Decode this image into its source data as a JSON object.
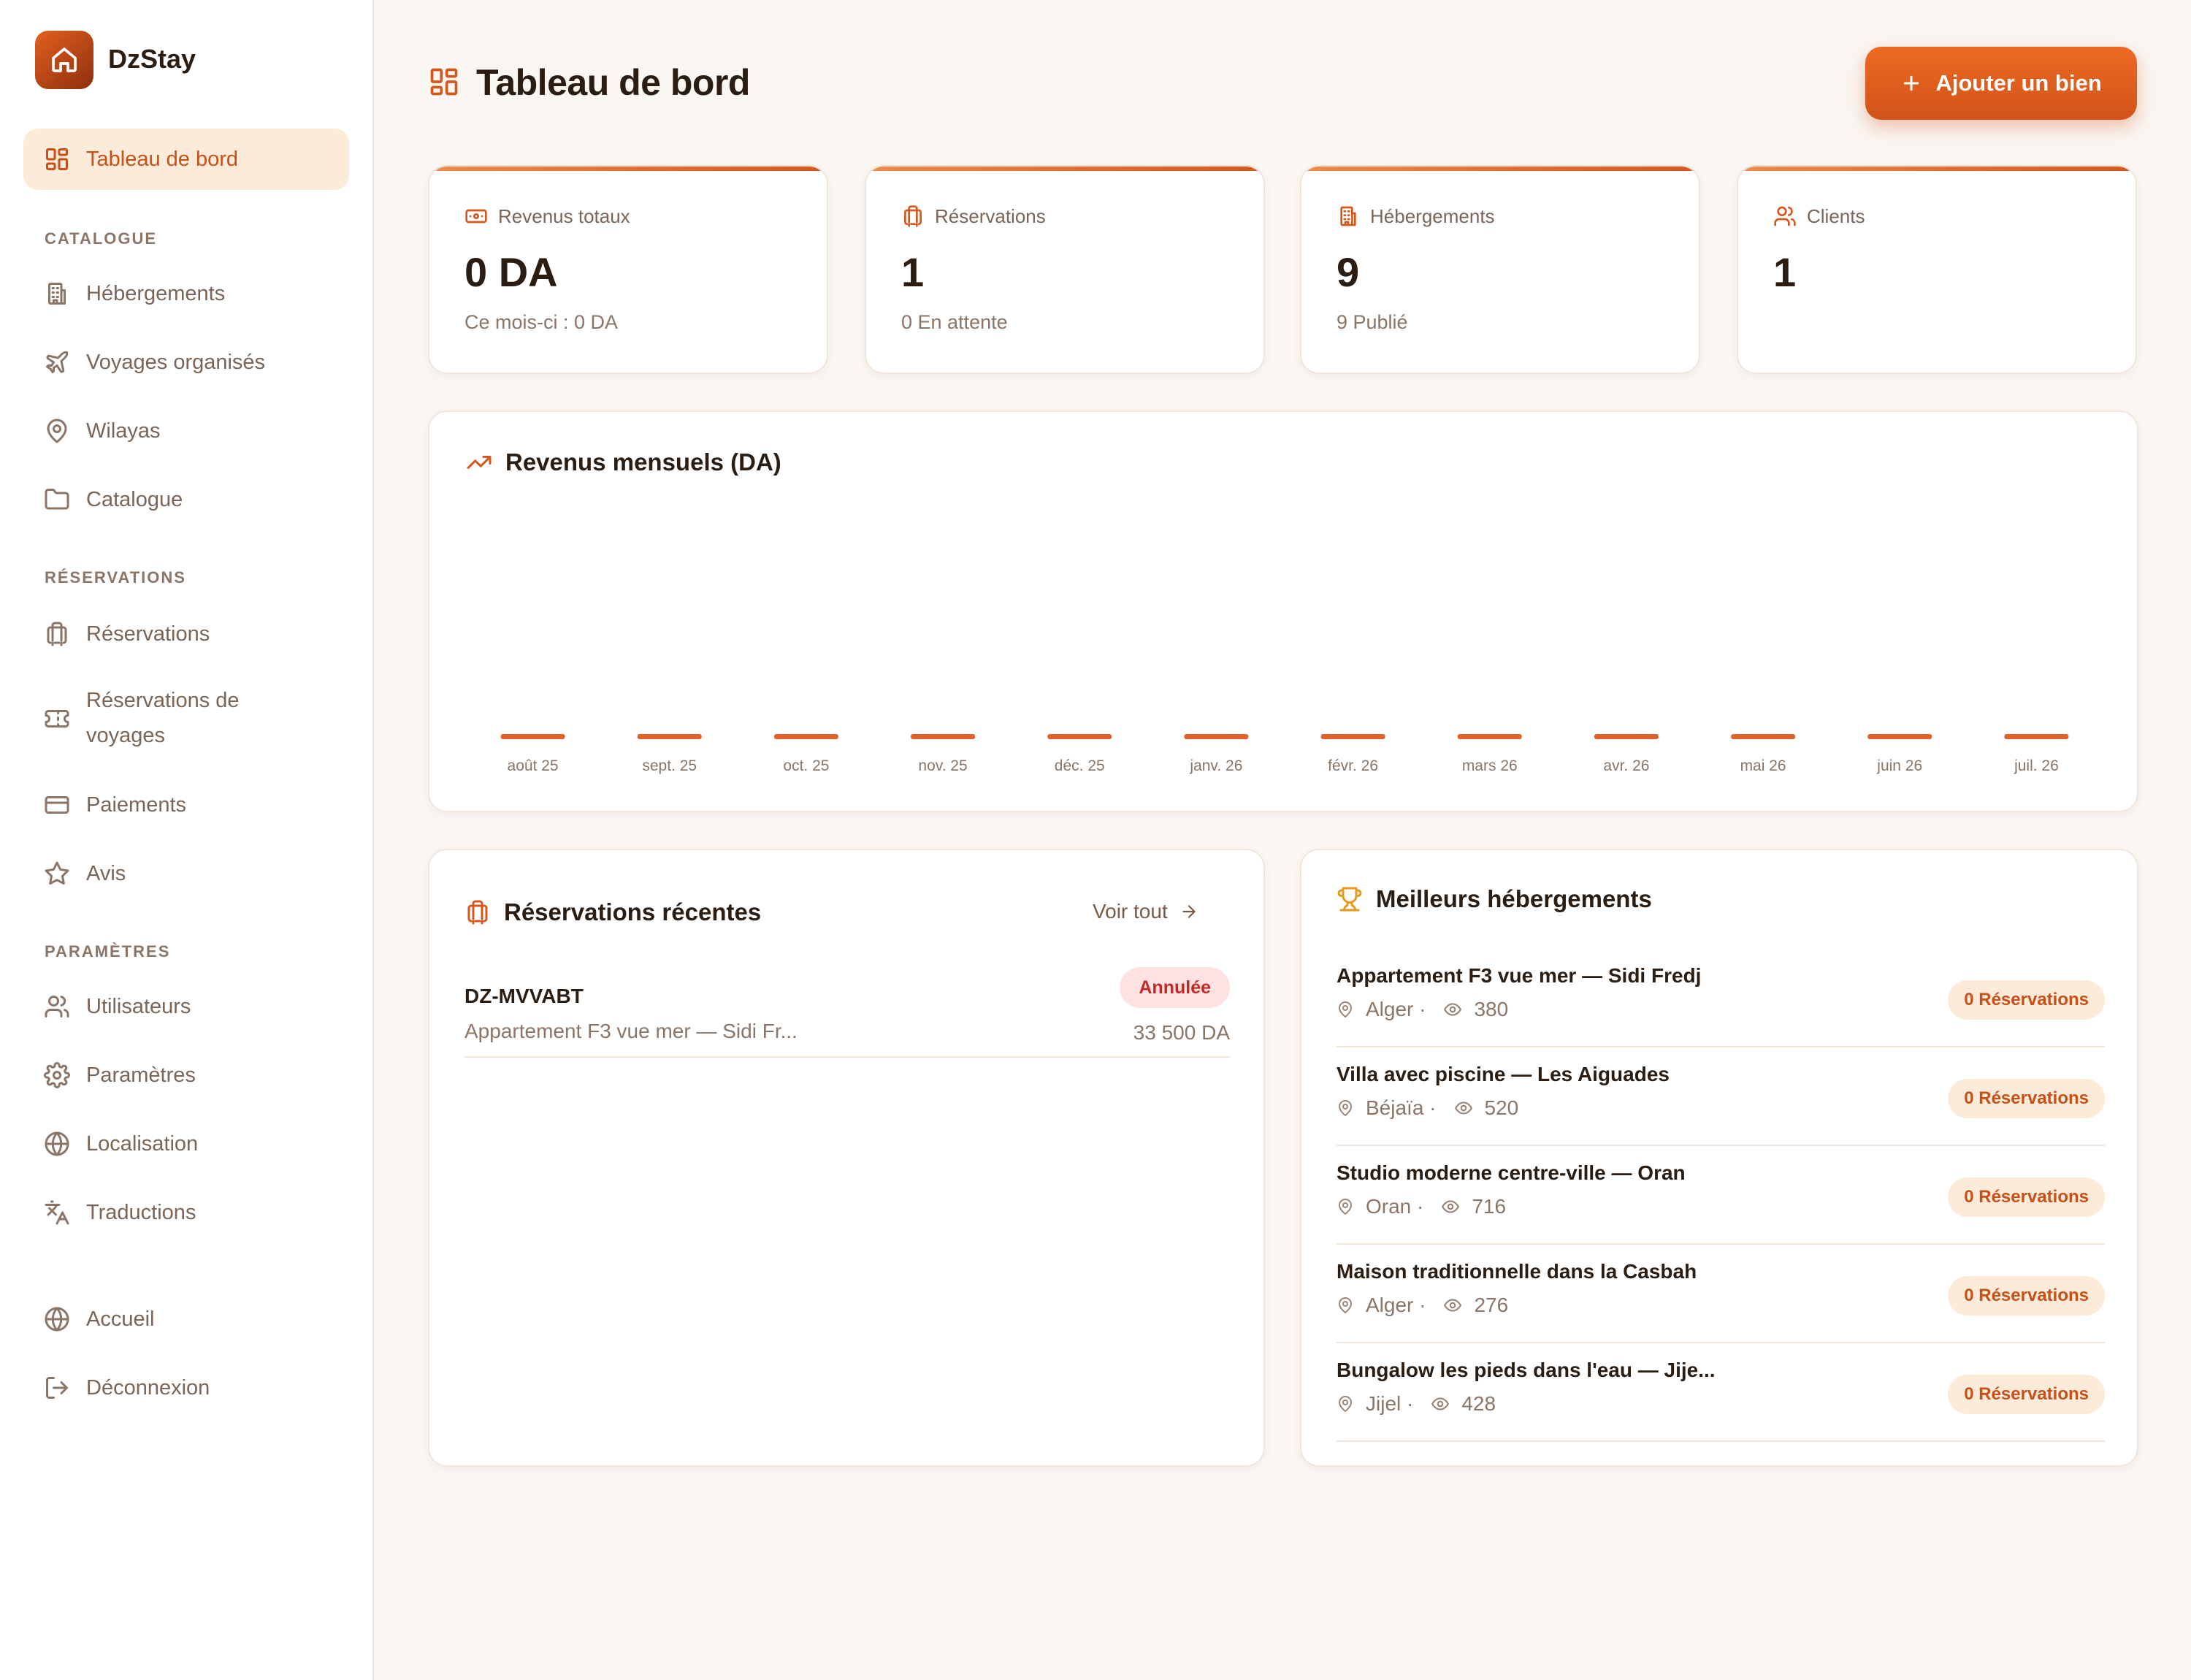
{
  "brand": {
    "name": "DzStay"
  },
  "sidebar": {
    "dashboard": "Tableau de bord",
    "sections": {
      "catalogue": "CATALOGUE",
      "reservations": "RÉSERVATIONS",
      "parametres": "PARAMÈTRES"
    },
    "items": {
      "hebergements": "Hébergements",
      "voyages": "Voyages organisés",
      "wilayas": "Wilayas",
      "catalogue": "Catalogue",
      "reservations": "Réservations",
      "reservations_voyages": "Réservations de voyages",
      "paiements": "Paiements",
      "avis": "Avis",
      "utilisateurs": "Utilisateurs",
      "parametres": "Paramètres",
      "localisation": "Localisation",
      "traductions": "Traductions",
      "accueil": "Accueil",
      "deconnexion": "Déconnexion"
    }
  },
  "header": {
    "title": "Tableau de bord",
    "add_button": "Ajouter un bien"
  },
  "stats": [
    {
      "label": "Revenus totaux",
      "value": "0 DA",
      "sub": "Ce mois-ci : 0 DA",
      "icon": "banknote-icon"
    },
    {
      "label": "Réservations",
      "value": "1",
      "sub": "0 En attente",
      "icon": "luggage-icon"
    },
    {
      "label": "Hébergements",
      "value": "9",
      "sub": "9 Publié",
      "icon": "building-icon"
    },
    {
      "label": "Clients",
      "value": "1",
      "sub": "",
      "icon": "users-icon"
    }
  ],
  "chart_data": {
    "type": "bar",
    "title": "Revenus mensuels (DA)",
    "categories": [
      "août 25",
      "sept. 25",
      "oct. 25",
      "nov. 25",
      "déc. 25",
      "janv. 26",
      "févr. 26",
      "mars 26",
      "avr. 26",
      "mai 26",
      "juin 26",
      "juil. 26"
    ],
    "values": [
      0,
      0,
      0,
      0,
      0,
      0,
      0,
      0,
      0,
      0,
      0,
      0
    ],
    "bar_color": "#e0622a"
  },
  "recent": {
    "title": "Réservations récentes",
    "see_all": "Voir tout",
    "items": [
      {
        "code": "DZ-MVVABT",
        "property": "Appartement F3 vue mer — Sidi Fr...",
        "status": "Annulée",
        "amount": "33 500 DA"
      }
    ]
  },
  "best": {
    "title": "Meilleurs hébergements",
    "items": [
      {
        "name": "Appartement F3 vue mer — Sidi Fredj",
        "city": "Alger ·",
        "views": "380",
        "badge": "0 Réservations"
      },
      {
        "name": "Villa avec piscine — Les Aiguades",
        "city": "Béjaïa ·",
        "views": "520",
        "badge": "0 Réservations"
      },
      {
        "name": "Studio moderne centre-ville — Oran",
        "city": "Oran ·",
        "views": "716",
        "badge": "0 Réservations"
      },
      {
        "name": "Maison traditionnelle dans la Casbah",
        "city": "Alger ·",
        "views": "276",
        "badge": "0 Réservations"
      },
      {
        "name": "Bungalow les pieds dans l'eau — Jije...",
        "city": "Jijel ·",
        "views": "428",
        "badge": "0 Réservations"
      }
    ]
  },
  "colors": {
    "accent": "#d4581d",
    "background": "#faf6f2",
    "danger": "#c02a26"
  }
}
